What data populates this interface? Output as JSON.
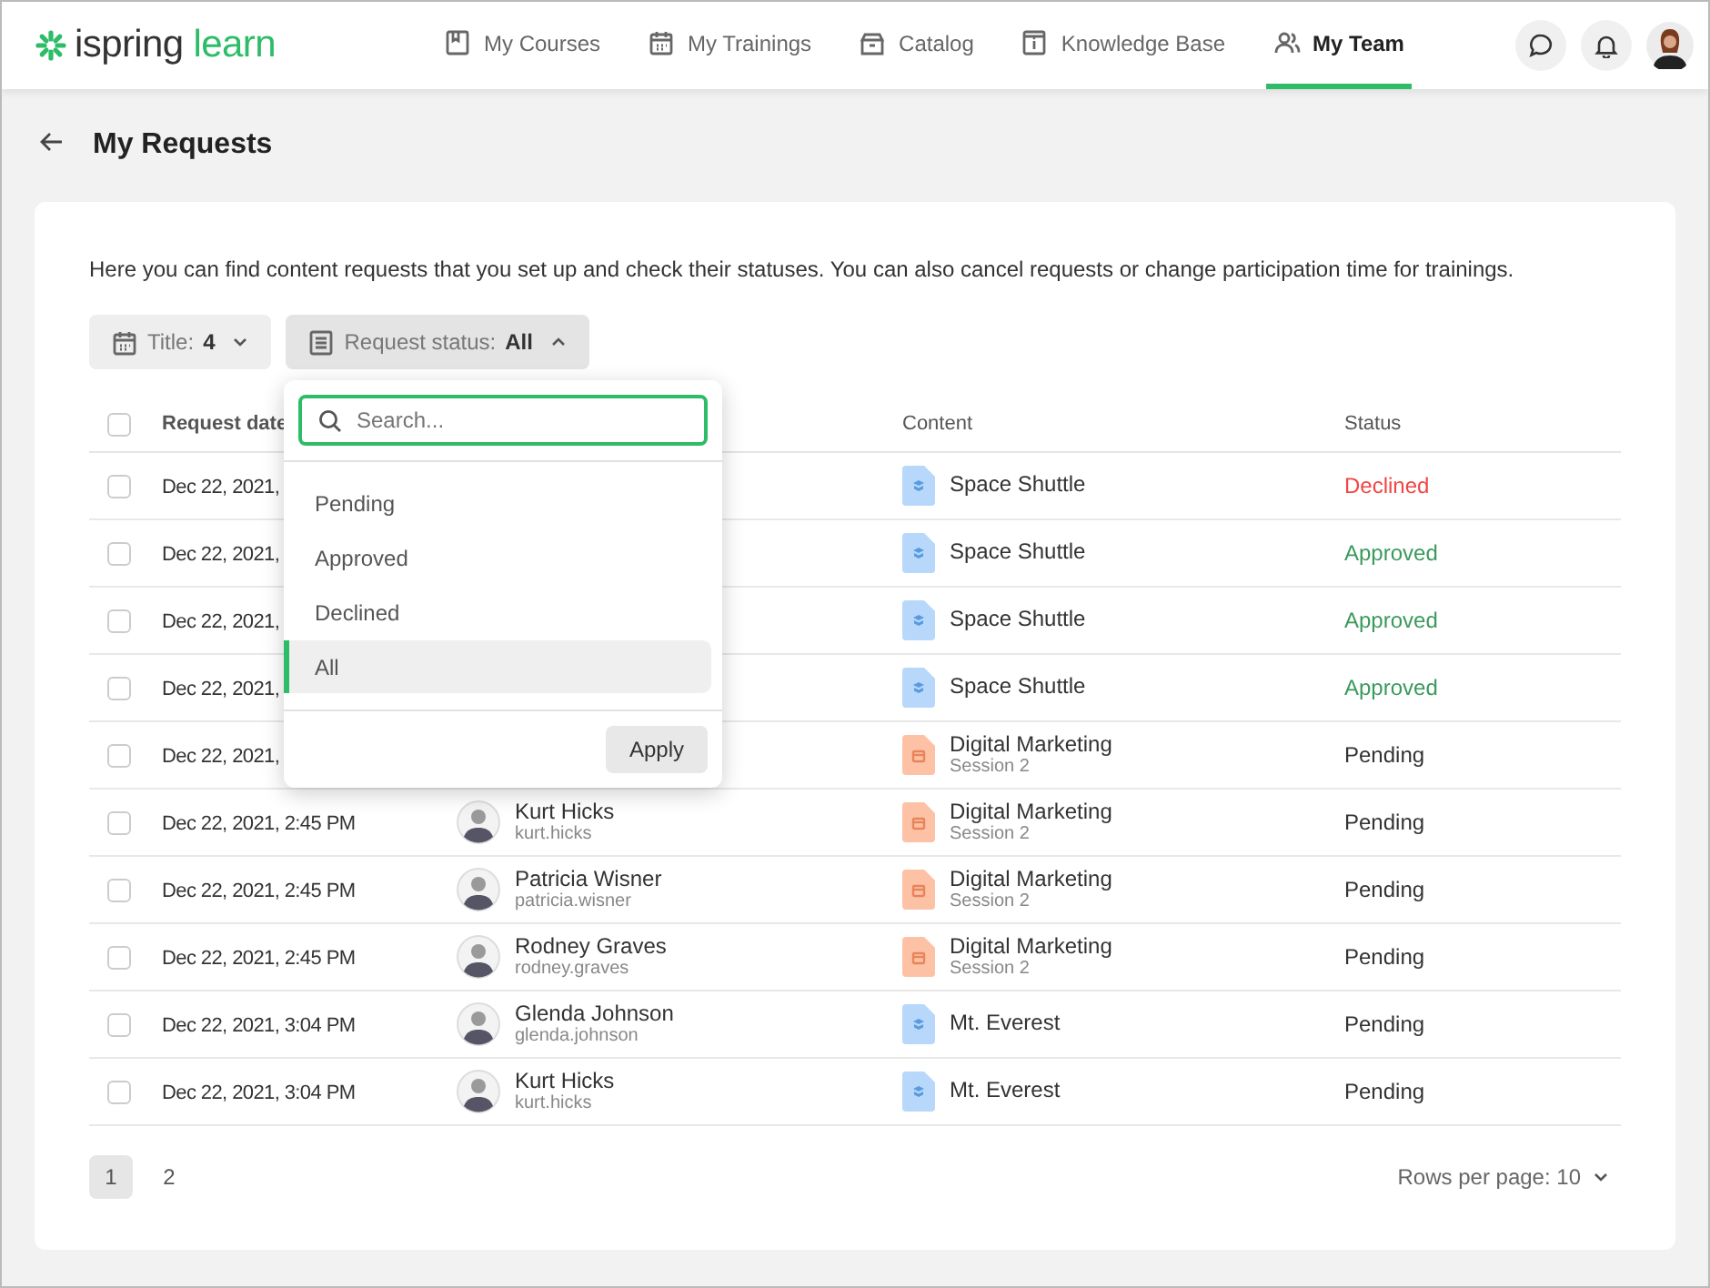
{
  "logo": {
    "brand": "ispring",
    "product": "learn"
  },
  "nav": [
    {
      "label": "My Courses",
      "selected": false
    },
    {
      "label": "My Trainings",
      "selected": false
    },
    {
      "label": "Catalog",
      "selected": false
    },
    {
      "label": "Knowledge Base",
      "selected": false
    },
    {
      "label": "My Team",
      "selected": true
    }
  ],
  "page_title": "My Requests",
  "intro": "Here you can find content requests that you set up and check their statuses. You can also cancel requests or change participation time for trainings.",
  "filters": [
    {
      "label": "Title:",
      "value": "4",
      "expanded": false
    },
    {
      "label": "Request status:",
      "value": "All",
      "expanded": true
    }
  ],
  "dropdown": {
    "placeholder": "Search...",
    "options": [
      {
        "label": "Pending",
        "selected": false
      },
      {
        "label": "Approved",
        "selected": false
      },
      {
        "label": "Declined",
        "selected": false
      },
      {
        "label": "All",
        "selected": true
      }
    ],
    "apply": "Apply"
  },
  "table": {
    "select_all_checked": false,
    "columns": [
      "Request date",
      "Content",
      "Status"
    ],
    "rows": [
      {
        "checked": false,
        "date": "Dec 22, 2021,",
        "content": {
          "kind": "course",
          "title": "Space Shuttle"
        },
        "status": {
          "text": "Declined",
          "kind": "declined"
        }
      },
      {
        "checked": false,
        "date": "Dec 22, 2021,",
        "content": {
          "kind": "course",
          "title": "Space Shuttle"
        },
        "status": {
          "text": "Approved",
          "kind": "approved"
        }
      },
      {
        "checked": false,
        "date": "Dec 22, 2021,",
        "content": {
          "kind": "course",
          "title": "Space Shuttle"
        },
        "status": {
          "text": "Approved",
          "kind": "approved"
        }
      },
      {
        "checked": false,
        "date": "Dec 22, 2021,",
        "content": {
          "kind": "course",
          "title": "Space Shuttle"
        },
        "status": {
          "text": "Approved",
          "kind": "approved"
        }
      },
      {
        "checked": false,
        "date": "Dec 22, 2021,",
        "content": {
          "kind": "training",
          "title": "Digital Marketing",
          "subtitle": "Session 2"
        },
        "status": {
          "text": "Pending",
          "kind": "pending"
        }
      },
      {
        "checked": false,
        "date": "Dec 22, 2021, 2:45 PM",
        "user": {
          "name": "Kurt Hicks",
          "login": "kurt.hicks"
        },
        "content": {
          "kind": "training",
          "title": "Digital Marketing",
          "subtitle": "Session 2"
        },
        "status": {
          "text": "Pending",
          "kind": "pending"
        }
      },
      {
        "checked": false,
        "date": "Dec 22, 2021, 2:45 PM",
        "user": {
          "name": "Patricia Wisner",
          "login": "patricia.wisner"
        },
        "content": {
          "kind": "training",
          "title": "Digital Marketing",
          "subtitle": "Session 2"
        },
        "status": {
          "text": "Pending",
          "kind": "pending"
        }
      },
      {
        "checked": false,
        "date": "Dec 22, 2021, 2:45 PM",
        "user": {
          "name": "Rodney Graves",
          "login": "rodney.graves"
        },
        "content": {
          "kind": "training",
          "title": "Digital Marketing",
          "subtitle": "Session 2"
        },
        "status": {
          "text": "Pending",
          "kind": "pending"
        }
      },
      {
        "checked": false,
        "date": "Dec 22, 2021, 3:04 PM",
        "user": {
          "name": "Glenda Johnson",
          "login": "glenda.johnson"
        },
        "content": {
          "kind": "course",
          "title": "Mt. Everest"
        },
        "status": {
          "text": "Pending",
          "kind": "pending"
        }
      },
      {
        "checked": false,
        "date": "Dec 22, 2021, 3:04 PM",
        "user": {
          "name": "Kurt Hicks",
          "login": "kurt.hicks"
        },
        "content": {
          "kind": "course",
          "title": "Mt. Everest"
        },
        "status": {
          "text": "Pending",
          "kind": "pending"
        }
      }
    ]
  },
  "pagination": {
    "pages": [
      {
        "label": "1",
        "selected": true
      },
      {
        "label": "2",
        "selected": false
      }
    ],
    "rows_per_page": "Rows per page: 10"
  }
}
